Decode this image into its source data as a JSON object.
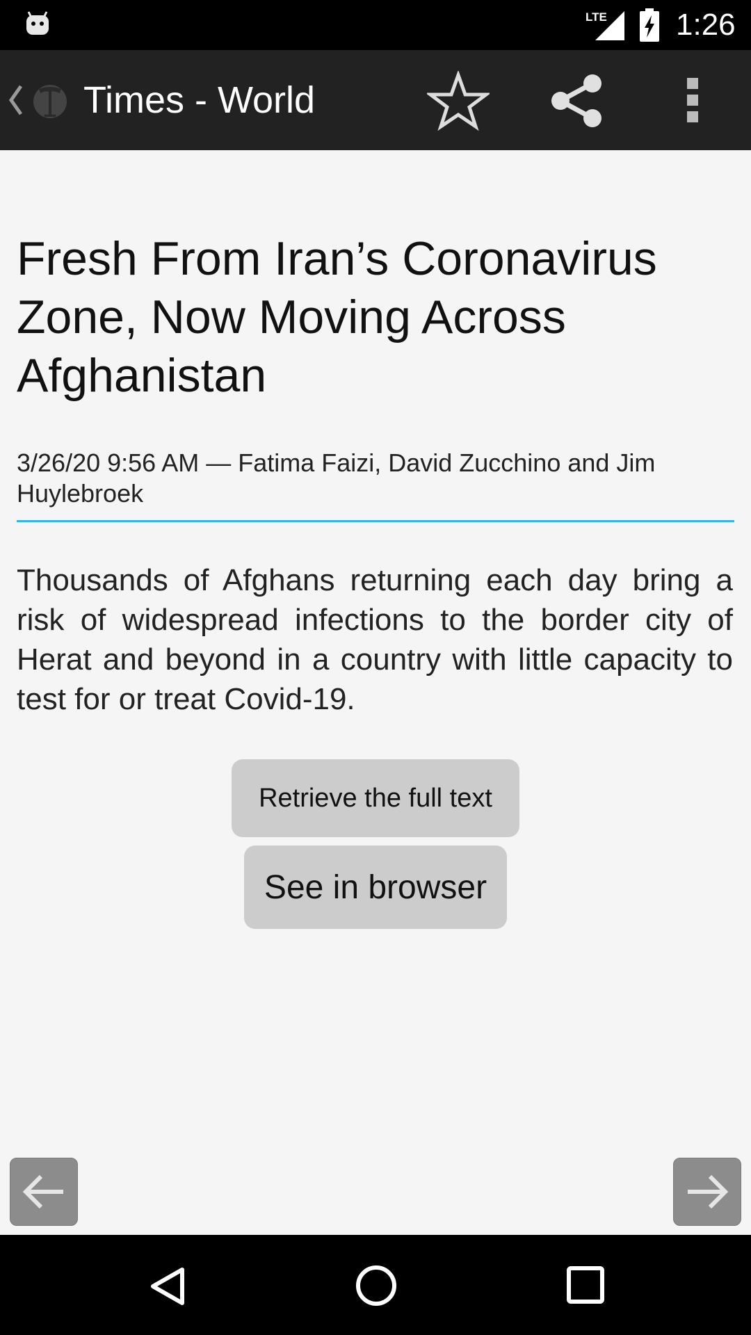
{
  "status_bar": {
    "time": "1:26",
    "network_label": "LTE",
    "icons": [
      "android-notification-icon",
      "lte-signal-icon",
      "battery-charging-icon"
    ]
  },
  "action_bar": {
    "title": "Times - World",
    "icons": [
      "back-icon",
      "nyt-logo-icon",
      "star-icon",
      "share-icon",
      "overflow-menu-icon"
    ]
  },
  "article": {
    "headline": "Fresh From Iran’s Coronavirus Zone, Now Moving Across Afghanistan",
    "byline": "3/26/20 9:56 AM — Fatima Faizi, David Zucchino and Jim Huylebroek",
    "summary": "Thousands of Afghans returning each day bring a risk of widespread infections to the border city of Herat and beyond in a country with little capacity to test for or treat Covid-19."
  },
  "buttons": {
    "retrieve_full_text": "Retrieve the full text",
    "see_in_browser": "See in browser"
  },
  "pager": {
    "icons": [
      "arrow-left-icon",
      "arrow-right-icon"
    ]
  },
  "system_nav": {
    "icons": [
      "nav-back-icon",
      "nav-home-icon",
      "nav-recents-icon"
    ]
  },
  "colors": {
    "status_bar_bg": "#000000",
    "action_bar_bg": "#222222",
    "page_bg": "#f5f5f5",
    "divider_accent": "#33b5e5",
    "button_bg": "#cccccc",
    "pager_button_bg": "#8c8c8c"
  }
}
